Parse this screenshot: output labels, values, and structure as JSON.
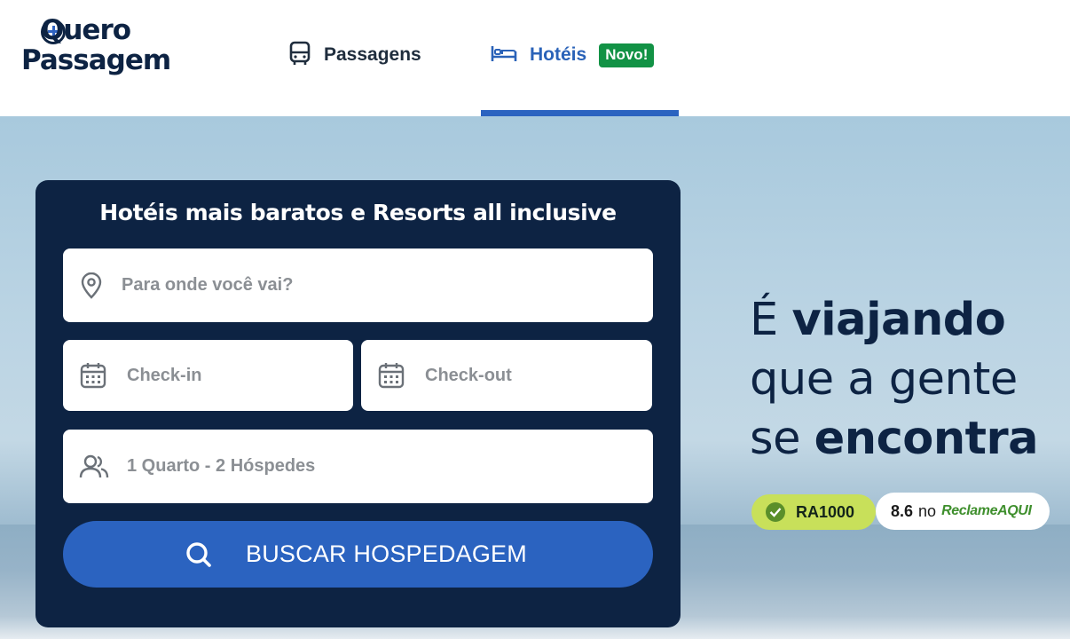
{
  "header": {
    "logo": {
      "line1": "Quero",
      "line2": "Passagem"
    },
    "tabs": [
      {
        "label": "Passagens",
        "icon": "bus-icon"
      },
      {
        "label": "Hotéis",
        "icon": "bed-icon",
        "badge": "Novo!"
      }
    ],
    "active_tab": "Hotéis",
    "colors": {
      "brand": "#0d2343",
      "accent": "#2b63c0",
      "badge": "#129245"
    }
  },
  "search": {
    "title": "Hotéis mais baratos e Resorts all inclusive",
    "destination_placeholder": "Para onde você vai?",
    "checkin_placeholder": "Check-in",
    "checkout_placeholder": "Check-out",
    "guests_value": "1 Quarto - 2 Hóspedes",
    "button_label": "BUSCAR HOSPEDAGEM"
  },
  "slogan": {
    "line1_regular": "É ",
    "line1_bold": "viajando",
    "line2_regular": "que a gente",
    "line3_regular": "se ",
    "line3_bold": "encontra"
  },
  "ratings": {
    "ra_badge": "RA1000",
    "score": "8.6",
    "score_connector": "no",
    "brand": "ReclameAQUI"
  }
}
